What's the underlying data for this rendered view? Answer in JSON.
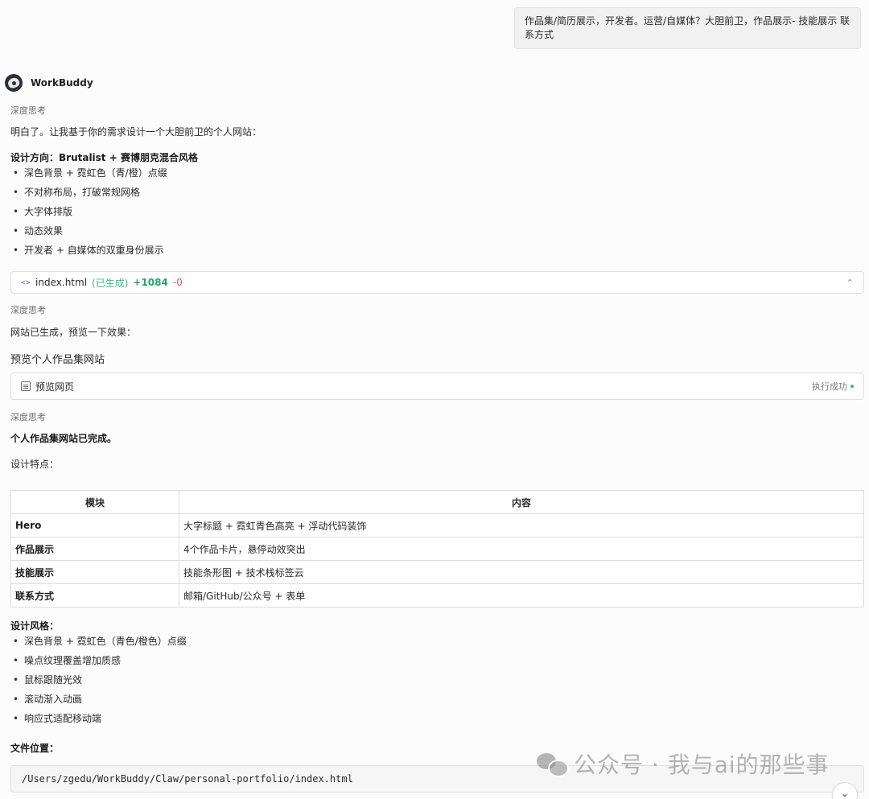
{
  "user_message": "作品集/简历展示，开发者。运营/自媒体？大胆前卫，作品展示- 技能展示 联系方式",
  "assistant": {
    "name": "WorkBuddy"
  },
  "thinking_label": "深度思考",
  "intro": "明白了。让我基于你的需求设计一个大胆前卫的个人网站：",
  "design_direction": {
    "title": "设计方向：Brutalist + 赛博朋克混合风格",
    "items": [
      "深色背景 + 霓虹色（青/橙）点缀",
      "不对称布局，打破常规网格",
      "大字体排版",
      "动态效果",
      "开发者 + 自媒体的双重身份展示"
    ]
  },
  "file_card": {
    "icon": "code-icon",
    "name": "index.html",
    "status": "(已生成)",
    "added": "+1084",
    "removed": "-0"
  },
  "generated_text": "网站已生成，预览一下效果：",
  "preview_title": "预览个人作品集网站",
  "preview_card": {
    "label": "预览网页",
    "status": "执行成功"
  },
  "complete_text": "个人作品集网站已完成。",
  "features_label": "设计特点：",
  "table": {
    "headers": [
      "模块",
      "内容"
    ],
    "rows": [
      [
        "Hero",
        "大字标题 + 霓虹青色高亮 + 浮动代码装饰"
      ],
      [
        "作品展示",
        "4个作品卡片，悬停动效突出"
      ],
      [
        "技能展示",
        "技能条形图 + 技术栈标签云"
      ],
      [
        "联系方式",
        "邮箱/GitHub/公众号 + 表单"
      ]
    ]
  },
  "design_style": {
    "title": "设计风格：",
    "items": [
      "深色背景 + 霓虹色（青色/橙色）点缀",
      "噪点纹理覆盖增加质感",
      "鼠标跟随光效",
      "滚动渐入动画",
      "响应式适配移动端"
    ]
  },
  "file_location_label": "文件位置：",
  "file_path": "/Users/zgedu/WorkBuddy/Claw/personal-portfolio/index.html",
  "watermark": "公众号 · 我与ai的那些事",
  "icons": {
    "expand": "expand-collapse-icon",
    "scroll": "chevron-down-icon"
  },
  "colors": {
    "added": "#27a36b",
    "removed": "#e25757",
    "success_dot": "#3cb88a"
  }
}
